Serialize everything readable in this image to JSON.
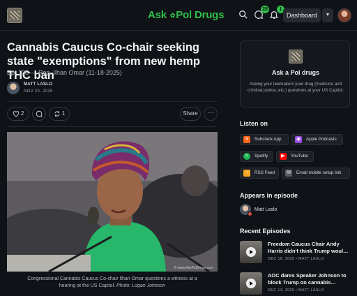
{
  "header": {
    "brand_part1": "Ask",
    "brand_part2": "Pol",
    "brand_part3": "Drugs",
    "chat_badge": "28",
    "notif_badge": "1",
    "dashboard_label": "Dashboard",
    "accent_color": "#2fbf4a"
  },
  "article": {
    "title": "Cannabis Caucus Co-chair seeking state \"exemptions\" from new hemp THC ban",
    "subtitle": "Ep. 138 — Rep. Ilhan Omar (11-18-2025)",
    "author": "MATT LASLO",
    "date": "NOV 23, 2025",
    "likes": "2",
    "restacks": "1",
    "share_label": "Share",
    "photo_watermark": "© www.AskPolDrugs.com",
    "caption_text": "Congressional Cannabis Caucus Co-chair Ilhan Omar questions a witness at a hearing at the US Capitol. ",
    "caption_credit": "Photo: Logan Johnson"
  },
  "sidebar": {
    "pub_name": "Ask a Pol drugs",
    "pub_desc": "Asking your lawmakers your drug (medicine and criminal justice, etc.) questions at your US Capitol.",
    "listen_title": "Listen on",
    "listen": [
      {
        "label": "Substack App",
        "icon": "substack-icon",
        "color": "#ff6719"
      },
      {
        "label": "Apple Podcasts",
        "icon": "apple-podcasts-icon",
        "color": "#9b4de0"
      },
      {
        "label": "Spotify",
        "icon": "spotify-icon",
        "color": "#1db954"
      },
      {
        "label": "YouTube",
        "icon": "youtube-icon",
        "color": "#ff0000"
      },
      {
        "label": "RSS Feed",
        "icon": "rss-icon",
        "color": "#f5a623"
      },
      {
        "label": "Email mobile setup link",
        "icon": "email-icon",
        "color": "#555b64"
      }
    ],
    "appears_title": "Appears in episode",
    "appears_name": "Matt Laslo",
    "recent_title": "Recent Episodes",
    "episodes": [
      {
        "title": "Freedom Caucus Chair Andy Harris didn't think Trump woul…",
        "meta": "DEC 18, 2025 • MATT LASLO"
      },
      {
        "title": "AOC dares Speaker Johnson to block Trump on cannabis…",
        "meta": "DEC 13, 2025 • MATT LASLO"
      }
    ]
  }
}
